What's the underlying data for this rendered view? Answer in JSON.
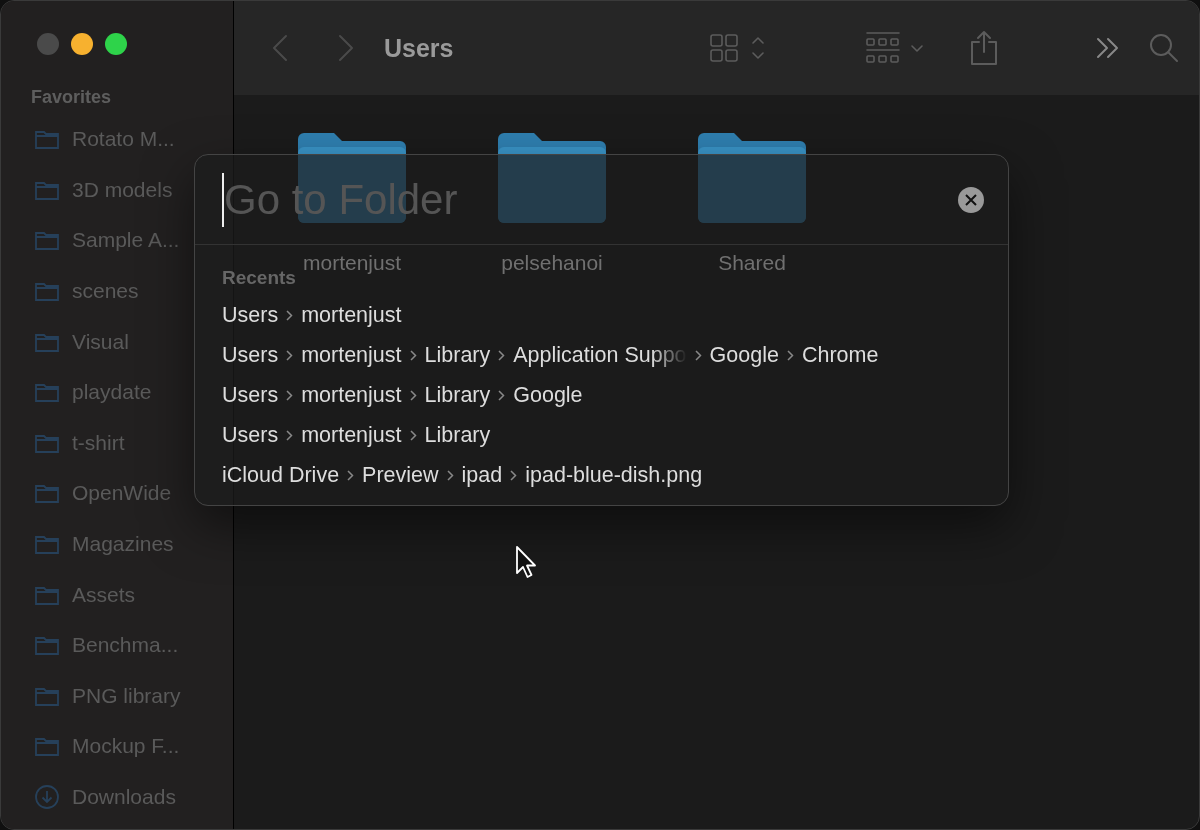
{
  "window": {
    "title": "Users"
  },
  "sidebar": {
    "heading": "Favorites",
    "items": [
      {
        "label": "Rotato M...",
        "kind": "folder"
      },
      {
        "label": "3D models",
        "kind": "folder"
      },
      {
        "label": "Sample A...",
        "kind": "folder"
      },
      {
        "label": "scenes",
        "kind": "folder"
      },
      {
        "label": "Visual",
        "kind": "folder"
      },
      {
        "label": "playdate",
        "kind": "folder"
      },
      {
        "label": "t-shirt",
        "kind": "folder"
      },
      {
        "label": "OpenWide",
        "kind": "folder"
      },
      {
        "label": "Magazines",
        "kind": "folder"
      },
      {
        "label": "Assets",
        "kind": "folder"
      },
      {
        "label": "Benchma...",
        "kind": "folder"
      },
      {
        "label": "PNG library",
        "kind": "folder"
      },
      {
        "label": "Mockup F...",
        "kind": "folder"
      },
      {
        "label": "Downloads",
        "kind": "download"
      }
    ]
  },
  "folders": [
    {
      "name": "mortenjust"
    },
    {
      "name": "pelsehanoi"
    },
    {
      "name": "Shared"
    }
  ],
  "dialog": {
    "field": {
      "placeholder": "Go to Folder"
    },
    "recents_heading": "Recents",
    "recents": [
      [
        "Users",
        "mortenjust"
      ],
      [
        "Users",
        "mortenjust",
        "Library",
        "Application Suppo",
        "Google",
        "Chrome"
      ],
      [
        "Users",
        "mortenjust",
        "Library",
        "Google"
      ],
      [
        "Users",
        "mortenjust",
        "Library"
      ],
      [
        "iCloud Drive",
        "Preview",
        "ipad",
        "ipad-blue-dish.png"
      ]
    ]
  }
}
